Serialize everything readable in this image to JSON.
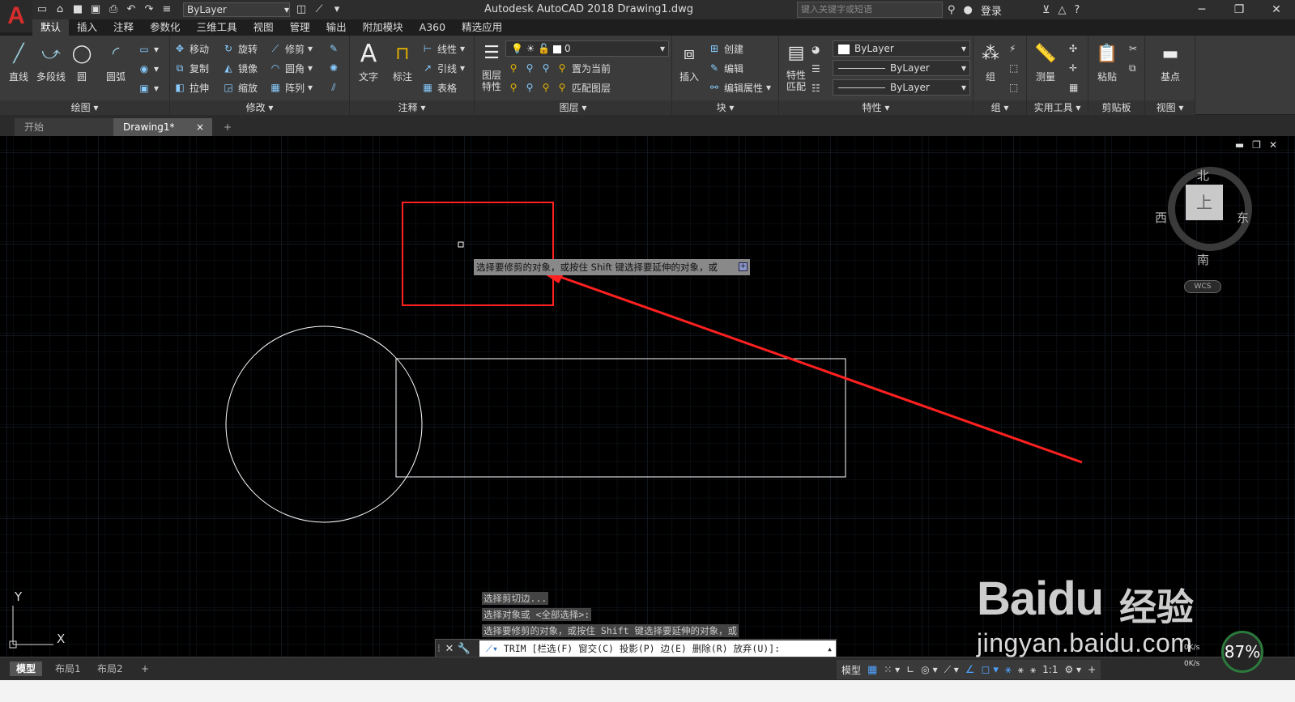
{
  "titlebar": {
    "app_title": "Autodesk AutoCAD 2018    Drawing1.dwg",
    "search_placeholder": "键入关键字或短语",
    "login": "登录",
    "quick_layer": "ByLayer",
    "logo": "A"
  },
  "ribbon_tabs": [
    "默认",
    "插入",
    "注释",
    "参数化",
    "三维工具",
    "视图",
    "管理",
    "输出",
    "附加模块",
    "A360",
    "精选应用"
  ],
  "panels": {
    "draw": {
      "label": "绘图 ▾",
      "line": "直线",
      "polyline": "多段线",
      "circle": "圆",
      "arc": "圆弧"
    },
    "modify": {
      "label": "修改 ▾",
      "move": "移动",
      "rotate": "旋转",
      "trim": "修剪",
      "copy": "复制",
      "mirror": "镜像",
      "fillet": "圆角",
      "stretch": "拉伸",
      "scale": "缩放",
      "array": "阵列"
    },
    "annotation": {
      "label": "注释 ▾",
      "text": "文字",
      "dimension": "标注",
      "linear": "线性",
      "leader": "引线",
      "table": "表格"
    },
    "layers": {
      "label": "图层 ▾",
      "layer_props": "图层\n特性",
      "current_layer": "0",
      "set_current": "置为当前",
      "match_layer": "匹配图层"
    },
    "block": {
      "label": "块 ▾",
      "insert": "插入",
      "create": "创建",
      "edit": "编辑",
      "edit_attr": "编辑属性"
    },
    "properties": {
      "label": "特性 ▾",
      "match": "特性\n匹配",
      "color": "ByLayer",
      "linetype": "ByLayer",
      "lineweight": "ByLayer"
    },
    "groups": {
      "label": "组 ▾",
      "group": "组"
    },
    "utilities": {
      "label": "实用工具 ▾",
      "measure": "测量"
    },
    "clipboard": {
      "label": "剪贴板",
      "paste": "粘贴"
    },
    "view": {
      "label": "视图 ▾",
      "base": "基点"
    }
  },
  "doc_tabs": {
    "start": "开始",
    "drawing": "Drawing1*",
    "close": "×",
    "add": "+"
  },
  "viewcube": {
    "north": "北",
    "south": "南",
    "east": "东",
    "west": "西",
    "top": "上",
    "wcs": "WCS"
  },
  "tooltip": {
    "text": "选择要修剪的对象，或按住 Shift 键选择要延伸的对象，或",
    "icon": "+"
  },
  "command_history": [
    "选择剪切边...",
    "选择对象或 <全部选择>:",
    "选择要修剪的对象，或按住 Shift 键选择要延伸的对象，或"
  ],
  "command_line": {
    "text": "TRIM [栏选(F) 窗交(C) 投影(P) 边(E) 删除(R) 放弃(U)]:"
  },
  "ucs": {
    "x": "X",
    "y": "Y"
  },
  "layout_tabs": [
    "模型",
    "布局1",
    "布局2"
  ],
  "status": {
    "model": "模型",
    "scale": "1:1"
  },
  "perf": {
    "percent": "87%",
    "up": "0K/s",
    "down": "0K/s"
  },
  "watermark": {
    "brand": "Baidu",
    "cn": "经验",
    "url": "jingyan.baidu.com"
  },
  "colors": {
    "annotation_red": "#ff2020",
    "canvas": "#000000",
    "grid": "#1a2330"
  }
}
